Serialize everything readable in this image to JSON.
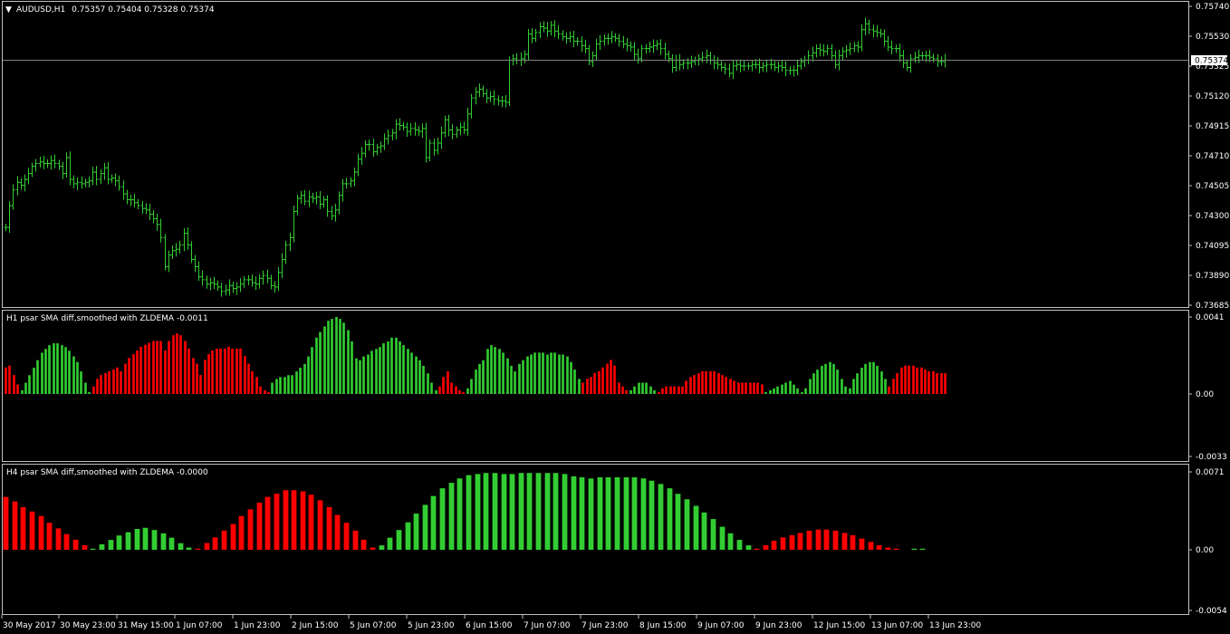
{
  "symbol_title": "AUDUSD,H1",
  "ohlc": "0.75357 0.75404 0.75328 0.75374",
  "current_price": "0.75374",
  "colors": {
    "background": "#000000",
    "frame": "#c0c0c0",
    "bars": "#32cd32",
    "positive": "#32cd32",
    "negative": "#ff0000",
    "grid": "#808080"
  },
  "x_axis_labels": [
    "30 May 2017",
    "30 May 23:00",
    "31 May 15:00",
    "1 Jun 07:00",
    "1 Jun 23:00",
    "2 Jun 15:00",
    "5 Jun 07:00",
    "5 Jun 23:00",
    "6 Jun 15:00",
    "7 Jun 07:00",
    "7 Jun 23:00",
    "8 Jun 15:00",
    "9 Jun 07:00",
    "9 Jun 23:00",
    "12 Jun 15:00",
    "13 Jun 07:00",
    "13 Jun 23:00"
  ],
  "chart_data": [
    {
      "type": "line",
      "title": "AUDUSD,H1 0.75357 0.75404 0.75328 0.75374",
      "y_ticks": [
        "0.75740",
        "0.75530",
        "0.75325",
        "0.75120",
        "0.74915",
        "0.74710",
        "0.74505",
        "0.74300",
        "0.74095",
        "0.73890",
        "0.73685"
      ],
      "ylim": [
        0.73685,
        0.7574
      ],
      "series": [
        {
          "values": [
            0.7422,
            0.7437,
            0.7448,
            0.7453,
            0.7451,
            0.7455,
            0.7459,
            0.7464,
            0.7466,
            0.7467,
            0.7466,
            0.7466,
            0.7468,
            0.7466,
            0.7464,
            0.7459,
            0.747,
            0.7455,
            0.7452,
            0.7453,
            0.7452,
            0.7453,
            0.7454,
            0.746,
            0.7455,
            0.7459,
            0.7463,
            0.7455,
            0.7456,
            0.7454,
            0.745,
            0.7445,
            0.7441,
            0.7441,
            0.7439,
            0.7437,
            0.7435,
            0.7434,
            0.7431,
            0.7428,
            0.7424,
            0.7415,
            0.7395,
            0.7403,
            0.7406,
            0.7407,
            0.741,
            0.7418,
            0.741,
            0.74,
            0.7395,
            0.7388,
            0.7386,
            0.7383,
            0.7384,
            0.7383,
            0.7381,
            0.7378,
            0.7379,
            0.7382,
            0.738,
            0.7381,
            0.7383,
            0.7386,
            0.7386,
            0.7384,
            0.7383,
            0.7387,
            0.7389,
            0.7387,
            0.7382,
            0.7381,
            0.7391,
            0.74,
            0.741,
            0.7415,
            0.7433,
            0.7442,
            0.7444,
            0.744,
            0.7443,
            0.7442,
            0.7443,
            0.7438,
            0.7441,
            0.7433,
            0.743,
            0.7434,
            0.7444,
            0.7452,
            0.7452,
            0.7454,
            0.746,
            0.7469,
            0.7473,
            0.7479,
            0.7479,
            0.7474,
            0.7477,
            0.7478,
            0.7483,
            0.7485,
            0.7487,
            0.7493,
            0.7492,
            0.7491,
            0.7488,
            0.749,
            0.7489,
            0.7488,
            0.749,
            0.747,
            0.748,
            0.7475,
            0.748,
            0.7487,
            0.7496,
            0.7489,
            0.7486,
            0.7489,
            0.7491,
            0.7489,
            0.75,
            0.7511,
            0.7515,
            0.7517,
            0.7514,
            0.7511,
            0.7512,
            0.751,
            0.7509,
            0.7509,
            0.7508,
            0.7537,
            0.7538,
            0.7537,
            0.7538,
            0.7541,
            0.7555,
            0.7552,
            0.7556,
            0.756,
            0.7559,
            0.7557,
            0.7561,
            0.7557,
            0.7555,
            0.7553,
            0.7552,
            0.7553,
            0.755,
            0.755,
            0.7547,
            0.7545,
            0.7536,
            0.754,
            0.7548,
            0.755,
            0.7552,
            0.7552,
            0.7553,
            0.7552,
            0.755,
            0.7548,
            0.7547,
            0.7546,
            0.7541,
            0.7538,
            0.7545,
            0.7545,
            0.7546,
            0.7547,
            0.7548,
            0.7545,
            0.7541,
            0.7538,
            0.7532,
            0.7537,
            0.7534,
            0.7535,
            0.7535,
            0.7536,
            0.7537,
            0.7538,
            0.7539,
            0.754,
            0.7537,
            0.7535,
            0.7534,
            0.7532,
            0.7531,
            0.7528,
            0.7533,
            0.7534,
            0.7533,
            0.7533,
            0.7533,
            0.7534,
            0.7534,
            0.7532,
            0.7533,
            0.7534,
            0.7534,
            0.7532,
            0.7533,
            0.7532,
            0.753,
            0.753,
            0.753,
            0.7533,
            0.7536,
            0.7537,
            0.754,
            0.7542,
            0.7545,
            0.7544,
            0.7543,
            0.7545,
            0.754,
            0.7534,
            0.754,
            0.7543,
            0.7544,
            0.7545,
            0.7547,
            0.7546,
            0.7558,
            0.7562,
            0.7558,
            0.7557,
            0.7556,
            0.7555,
            0.755,
            0.7546,
            0.7545,
            0.7545,
            0.754,
            0.7535,
            0.7532,
            0.7538,
            0.7539,
            0.754,
            0.754,
            0.754,
            0.7539,
            0.7538,
            0.7536,
            0.7536,
            0.7537
          ]
        }
      ]
    },
    {
      "type": "bar",
      "title": "H1 psar SMA diff,smoothed with ZLDEMA -0.0011",
      "y_ticks": [
        "0.0041",
        "0.00",
        "-0.0033"
      ],
      "ylim": [
        -0.0033,
        0.0041
      ],
      "series": [
        {
          "values": [
            -0.0014,
            -0.0015,
            -0.001,
            -0.0005,
            0.0002,
            0.0006,
            0.001,
            0.0014,
            0.0018,
            0.0022,
            0.0024,
            0.0026,
            0.0027,
            0.0027,
            0.0026,
            0.0025,
            0.0023,
            0.002,
            0.0017,
            0.0012,
            0.0006,
            0.0001,
            -0.0004,
            -0.0008,
            -0.001,
            -0.0011,
            -0.0012,
            -0.0013,
            -0.0014,
            -0.0012,
            -0.0016,
            -0.0019,
            -0.0021,
            -0.0023,
            -0.0025,
            -0.0026,
            -0.0027,
            -0.0028,
            -0.0028,
            -0.0028,
            -0.0023,
            -0.0028,
            -0.0031,
            -0.0032,
            -0.0031,
            -0.0028,
            -0.0024,
            -0.0019,
            -0.0016,
            -0.001,
            -0.0018,
            -0.0021,
            -0.0023,
            -0.0024,
            -0.0024,
            -0.0024,
            -0.0025,
            -0.0024,
            -0.0024,
            -0.0024,
            -0.002,
            -0.0016,
            -0.0012,
            -0.0009,
            -0.0004,
            -0.0002,
            -0.0001,
            0.0006,
            0.0008,
            0.0009,
            0.0009,
            0.001,
            0.001,
            0.0012,
            0.0014,
            0.0016,
            0.002,
            0.0025,
            0.003,
            0.0033,
            0.0036,
            0.0039,
            0.004,
            0.0041,
            0.004,
            0.0038,
            0.0034,
            0.0028,
            0.0019,
            0.0018,
            0.002,
            0.0021,
            0.0023,
            0.0024,
            0.0025,
            0.0027,
            0.0028,
            0.003,
            0.003,
            0.0028,
            0.0026,
            0.0024,
            0.0022,
            0.002,
            0.0018,
            0.0015,
            0.0011,
            0.0006,
            0.0002,
            -0.0004,
            -0.0009,
            -0.0012,
            -0.0006,
            -0.0004,
            -0.0002,
            -0.0001,
            0.0003,
            0.0008,
            0.0013,
            0.0016,
            0.0018,
            0.0024,
            0.0026,
            0.0025,
            0.0024,
            0.0022,
            0.0019,
            0.0015,
            0.0012,
            0.0016,
            0.0018,
            0.002,
            0.0021,
            0.0022,
            0.0022,
            0.0022,
            0.0021,
            0.0022,
            0.0022,
            0.0021,
            0.0021,
            0.002,
            0.0017,
            0.0013,
            0.0008,
            -0.0006,
            -0.0008,
            -0.0009,
            -0.0011,
            -0.0012,
            -0.0014,
            -0.0016,
            -0.0018,
            -0.0015,
            -0.0006,
            -0.0004,
            -0.0002,
            0.0002,
            0.0004,
            0.0006,
            0.0006,
            0.0006,
            0.0004,
            0.0002,
            -0.0001,
            -0.0003,
            -0.0004,
            -0.0004,
            -0.0004,
            -0.0004,
            -0.0004,
            -0.0007,
            -0.0009,
            -0.001,
            -0.0011,
            -0.0012,
            -0.0012,
            -0.0012,
            -0.0012,
            -0.0011,
            -0.001,
            -0.0009,
            -0.0008,
            -0.0007,
            -0.0006,
            -0.0006,
            -0.0006,
            -0.0006,
            -0.0006,
            -0.0006,
            -0.0005,
            0.0001,
            0.0002,
            0.0003,
            0.0004,
            0.0005,
            0.0006,
            0.0007,
            0.0005,
            0.0003,
            0.0001,
            0.0003,
            0.0008,
            0.0011,
            0.0013,
            0.0015,
            0.0016,
            0.0017,
            0.0016,
            0.0013,
            0.0008,
            0.0004,
            0.0003,
            0.0008,
            0.0011,
            0.0014,
            0.0016,
            0.0017,
            0.0017,
            0.0015,
            0.0012,
            0.0008,
            -0.0004,
            -0.0008,
            -0.0011,
            -0.0014,
            -0.0015,
            -0.0015,
            -0.0015,
            -0.0014,
            -0.0014,
            -0.0013,
            -0.0012,
            -0.0012,
            -0.0011,
            -0.0011,
            -0.0011
          ]
        }
      ]
    },
    {
      "type": "bar",
      "title": "H4 psar SMA diff,smoothed with ZLDEMA -0.0000",
      "y_ticks": [
        "0.0071",
        "0.00",
        "-0.0054"
      ],
      "ylim": [
        -0.0054,
        0.0071
      ],
      "series": [
        {
          "values": [
            -0.0047,
            -0.0043,
            -0.0038,
            -0.0034,
            -0.003,
            -0.0024,
            -0.0019,
            -0.0014,
            -0.0009,
            -0.0004,
            0.0001,
            0.0005,
            0.0009,
            0.0013,
            0.0016,
            0.0019,
            0.002,
            0.0018,
            0.0015,
            0.0011,
            0.0006,
            0.0002,
            -0.0001,
            -0.0006,
            -0.0011,
            -0.0017,
            -0.0023,
            -0.003,
            -0.0036,
            -0.0042,
            -0.0047,
            -0.005,
            -0.0053,
            -0.0053,
            -0.0052,
            -0.0049,
            -0.0044,
            -0.0038,
            -0.0031,
            -0.0024,
            -0.0017,
            -0.0009,
            -0.0002,
            0.0004,
            0.0011,
            0.0018,
            0.0025,
            0.0033,
            0.0041,
            0.0049,
            0.0056,
            0.0061,
            0.0065,
            0.0068,
            0.0069,
            0.007,
            0.007,
            0.0069,
            0.0069,
            0.007,
            0.007,
            0.007,
            0.007,
            0.007,
            0.0069,
            0.0067,
            0.0066,
            0.0065,
            0.0066,
            0.0066,
            0.0066,
            0.0066,
            0.0066,
            0.0065,
            0.0063,
            0.006,
            0.0056,
            0.0051,
            0.0046,
            0.004,
            0.0034,
            0.0028,
            0.0021,
            0.0015,
            0.0009,
            0.0004,
            -0.0001,
            -0.0004,
            -0.0008,
            -0.0011,
            -0.0013,
            -0.0015,
            -0.0017,
            -0.0018,
            -0.0018,
            -0.0017,
            -0.0015,
            -0.0013,
            -0.001,
            -0.0007,
            -0.0004,
            -0.0002,
            -0.0001,
            0.0,
            0.0001,
            0.0001,
            0.0
          ]
        }
      ]
    }
  ]
}
